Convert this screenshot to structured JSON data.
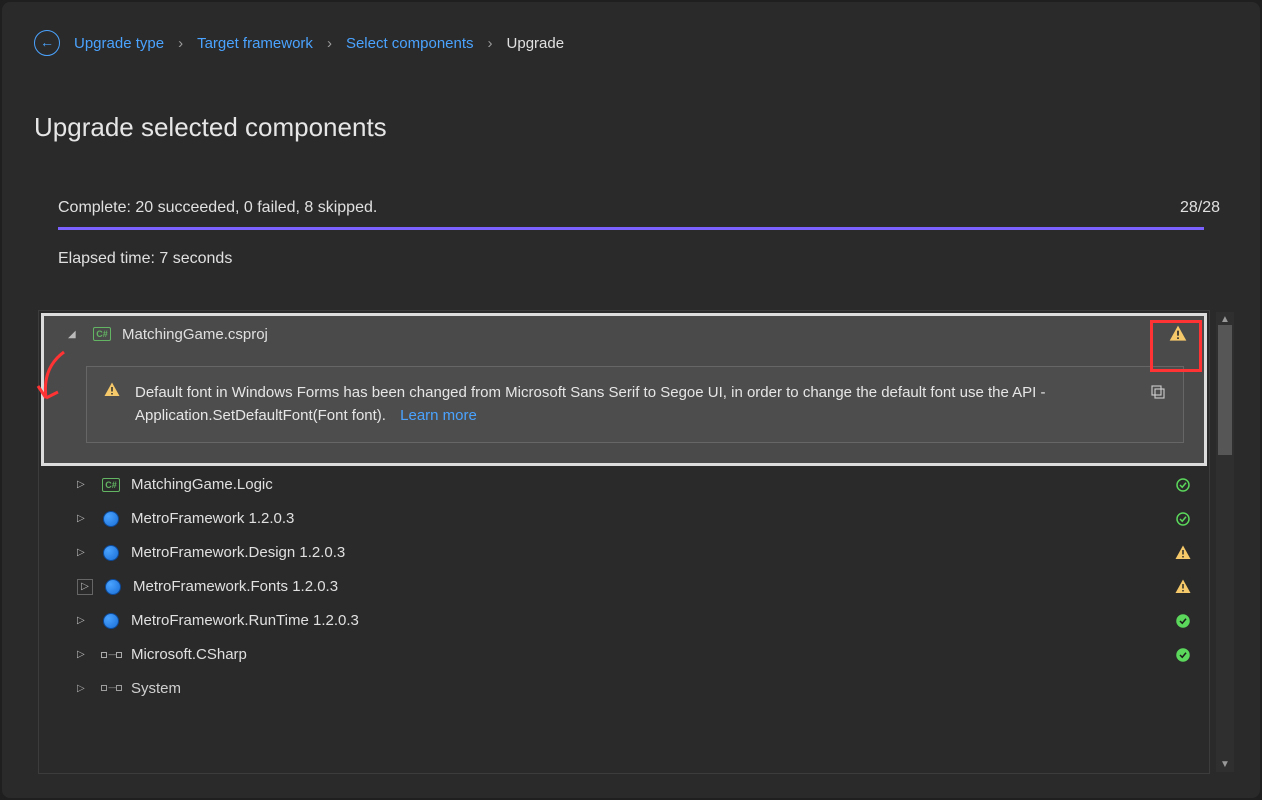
{
  "breadcrumb": {
    "items": [
      "Upgrade type",
      "Target framework",
      "Select components"
    ],
    "current": "Upgrade"
  },
  "page_title": "Upgrade selected components",
  "progress": {
    "status_text": "Complete: 20 succeeded, 0 failed, 8 skipped.",
    "counter": "28/28",
    "elapsed": "Elapsed time: 7 seconds"
  },
  "tree": {
    "expanded": {
      "label": "MatchingGame.csproj",
      "status": "warning",
      "warning_message": "Default font in Windows Forms has been changed from Microsoft Sans Serif to Segoe UI, in order to change the default font use the API - Application.SetDefaultFont(Font font).",
      "learn_more": "Learn more"
    },
    "items": [
      {
        "icon": "csproj",
        "label": "MatchingGame.Logic",
        "status": "check"
      },
      {
        "icon": "nuget",
        "label": "MetroFramework 1.2.0.3",
        "status": "check"
      },
      {
        "icon": "nuget",
        "label": "MetroFramework.Design 1.2.0.3",
        "status": "warning"
      },
      {
        "icon": "nuget",
        "label": "MetroFramework.Fonts 1.2.0.3",
        "status": "warning",
        "expander_outlined": true
      },
      {
        "icon": "nuget",
        "label": "MetroFramework.RunTime 1.2.0.3",
        "status": "check-full"
      },
      {
        "icon": "ref",
        "label": "Microsoft.CSharp",
        "status": "check-full"
      },
      {
        "icon": "ref",
        "label": "System",
        "status": ""
      }
    ]
  },
  "icons": {
    "cs_label": "C#"
  }
}
